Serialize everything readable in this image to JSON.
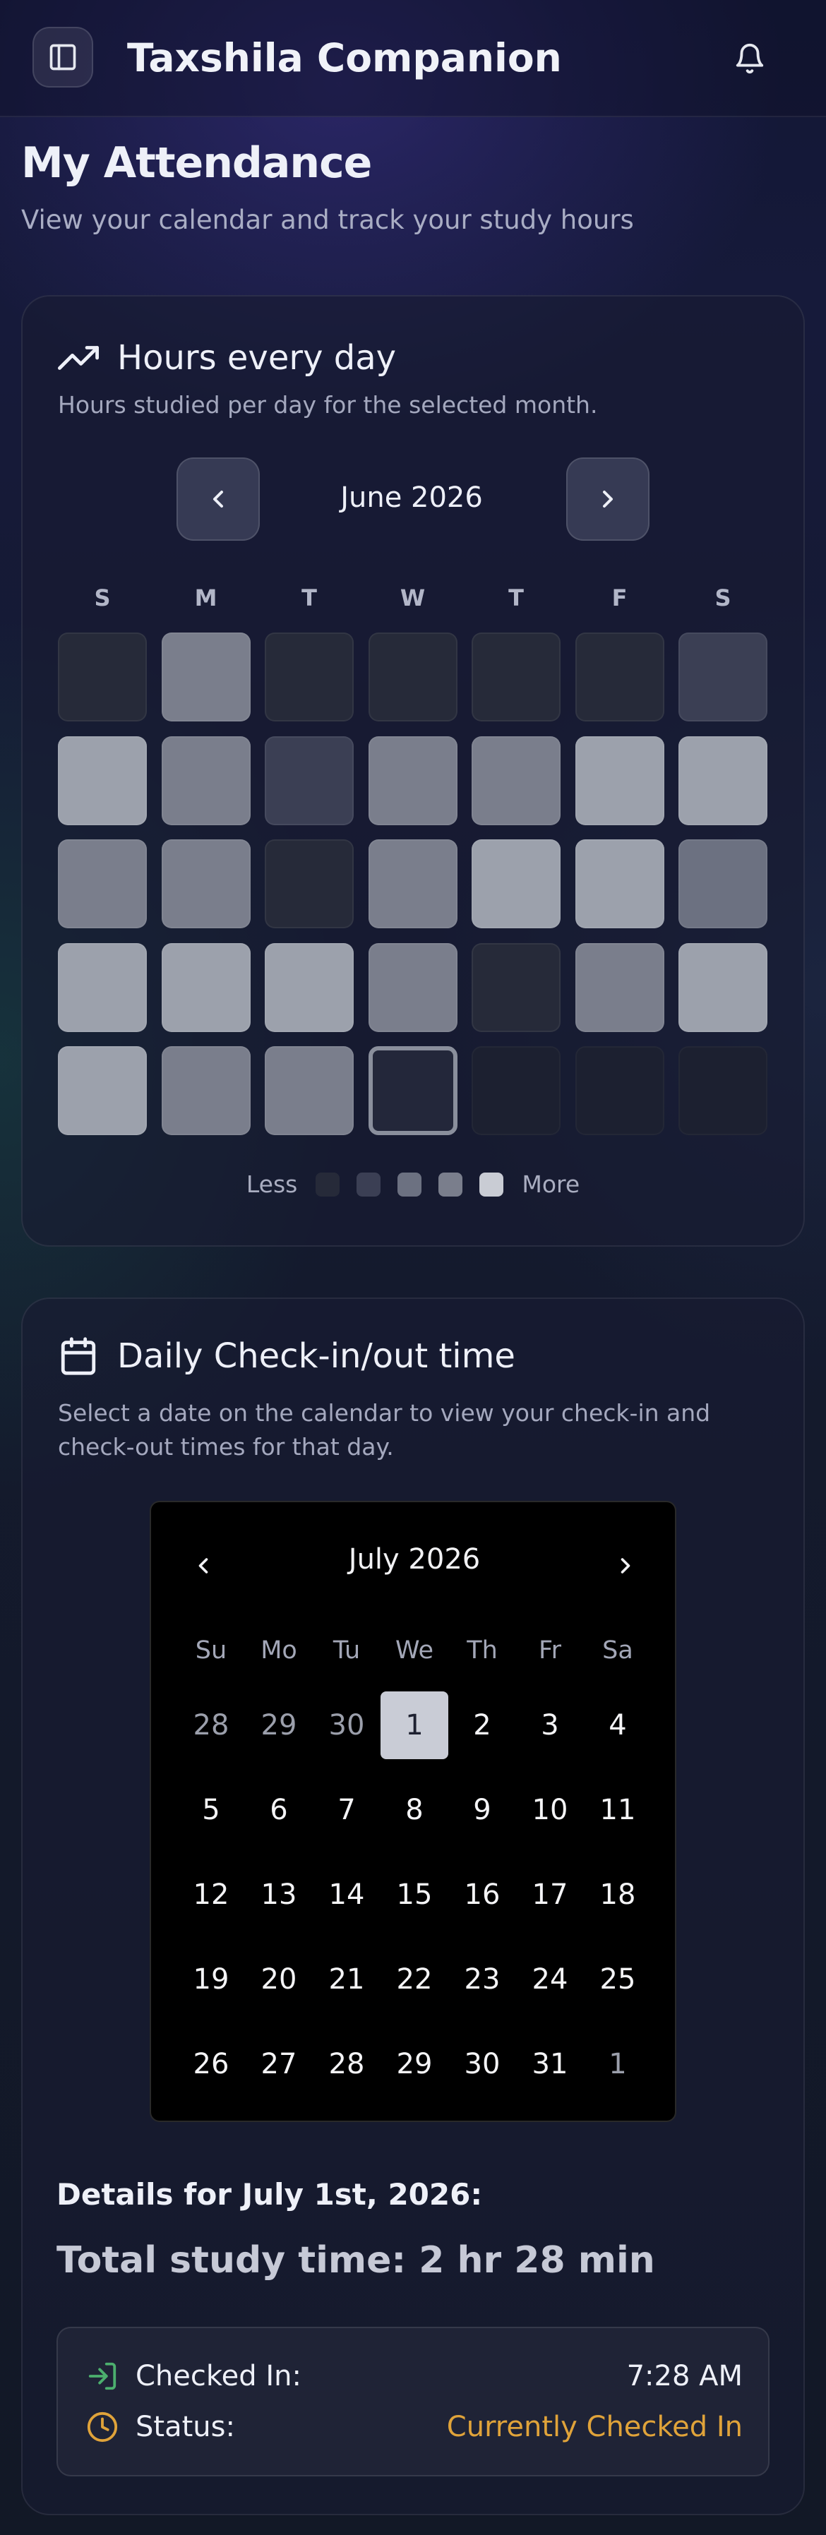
{
  "header": {
    "app_title": "Taxshila Companion",
    "menu_icon": "sidebar-toggle-icon",
    "bell_icon": "bell-icon"
  },
  "page": {
    "title": "My Attendance",
    "subtitle": "View your calendar and track your study hours"
  },
  "hours_card": {
    "icon": "trending-up-icon",
    "title": "Hours every day",
    "description": "Hours studied per day for the selected month.",
    "month_label": "June 2026",
    "weekdays": [
      "S",
      "M",
      "T",
      "W",
      "T",
      "F",
      "S"
    ],
    "heatmap_levels": [
      [
        0,
        3,
        0,
        0,
        0,
        0,
        1
      ],
      [
        4,
        3,
        1,
        3,
        3,
        4,
        4
      ],
      [
        3,
        3,
        0,
        3,
        4,
        4,
        2
      ],
      [
        4,
        4,
        4,
        3,
        0,
        3,
        4
      ],
      [
        4,
        3,
        3,
        "today",
        "empty",
        "empty",
        "empty"
      ]
    ],
    "legend": {
      "less": "Less",
      "more": "More",
      "colors": [
        "#262a39",
        "#3b3f54",
        "#6c7181",
        "#7a7e8c",
        "#c9ccd4"
      ]
    }
  },
  "daily_card": {
    "icon": "calendar-icon",
    "title": "Daily Check-in/out time",
    "description": "Select a date on the calendar to view your check-in and check-out times for that day.",
    "calendar": {
      "month_label": "July 2026",
      "weekdays": [
        "Su",
        "Mo",
        "Tu",
        "We",
        "Th",
        "Fr",
        "Sa"
      ],
      "weeks": [
        [
          "28",
          "29",
          "30",
          "1",
          "2",
          "3",
          "4"
        ],
        [
          "5",
          "6",
          "7",
          "8",
          "9",
          "10",
          "11"
        ],
        [
          "12",
          "13",
          "14",
          "15",
          "16",
          "17",
          "18"
        ],
        [
          "19",
          "20",
          "21",
          "22",
          "23",
          "24",
          "25"
        ],
        [
          "26",
          "27",
          "28",
          "29",
          "30",
          "31",
          "1"
        ]
      ],
      "selected_day": "1"
    },
    "details_title": "Details for July 1st, 2026:",
    "total_study_time": "Total study time: 2 hr 28 min",
    "checked_in_label": "Checked In:",
    "checked_in_value": "7:28 AM",
    "status_label": "Status:",
    "status_value": "Currently Checked In",
    "colors": {
      "checkin_icon": "#4caf6e",
      "status_accent": "#e0a33a"
    }
  }
}
